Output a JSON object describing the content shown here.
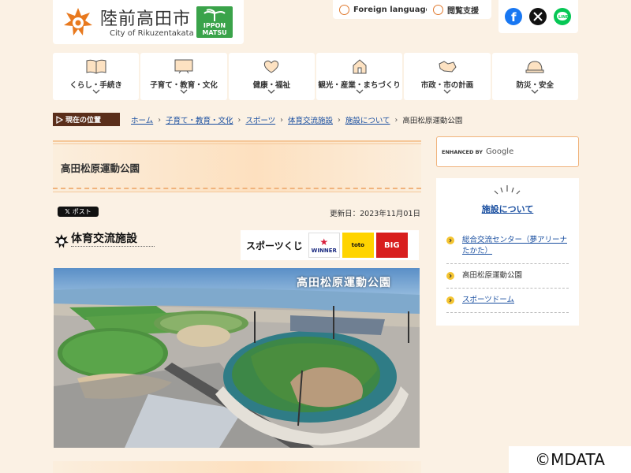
{
  "header": {
    "city_name": "陸前高田市",
    "city_name_en": "City of Rikuzentakata",
    "ippon_text": "IPPON\nMATSU",
    "foreign_language": "Foreign language",
    "reading_support": "閲覧支援"
  },
  "nav": {
    "items": [
      {
        "label": "くらし・手続き",
        "icon": "book-icon"
      },
      {
        "label": "子育て・教育・文化",
        "icon": "board-icon"
      },
      {
        "label": "健康・福祉",
        "icon": "heart-hands-icon"
      },
      {
        "label": "観光・産業・まちづくり",
        "icon": "house-tree-icon"
      },
      {
        "label": "市政・市の計画",
        "icon": "map-icon"
      },
      {
        "label": "防災・安全",
        "icon": "helmet-icon"
      }
    ]
  },
  "breadcrumb": {
    "here_label": "現在の位置",
    "items": [
      "ホーム",
      "子育て・教育・文化",
      "スポーツ",
      "体育交流施設",
      "施設について"
    ],
    "current": "高田松原運動公園"
  },
  "main": {
    "page_title": "高田松原運動公園",
    "post_label": "ポスト",
    "updated": "更新日：2023年11月01日",
    "facility_label": "体育交流施設",
    "sponsor_text": "スポーツくじ",
    "sponsor_tiles": [
      "WINNER",
      "toto",
      "BIG"
    ],
    "photo_caption": "高田松原運動公園"
  },
  "sidebar": {
    "search_enhanced": "ENHANCED BY",
    "search_google": "Google",
    "title": "施設について",
    "items": [
      {
        "label": "総合交流センター（夢アリーナたかた）",
        "current": false
      },
      {
        "label": "高田松原運動公園",
        "current": true
      },
      {
        "label": "スポーツドーム",
        "current": false
      }
    ]
  },
  "watermark": "©MDATA",
  "colors": {
    "background": "#fbf1e4",
    "accent": "#e07a2f",
    "link": "#1a4fa0",
    "here_badge": "#5a2e1a"
  }
}
